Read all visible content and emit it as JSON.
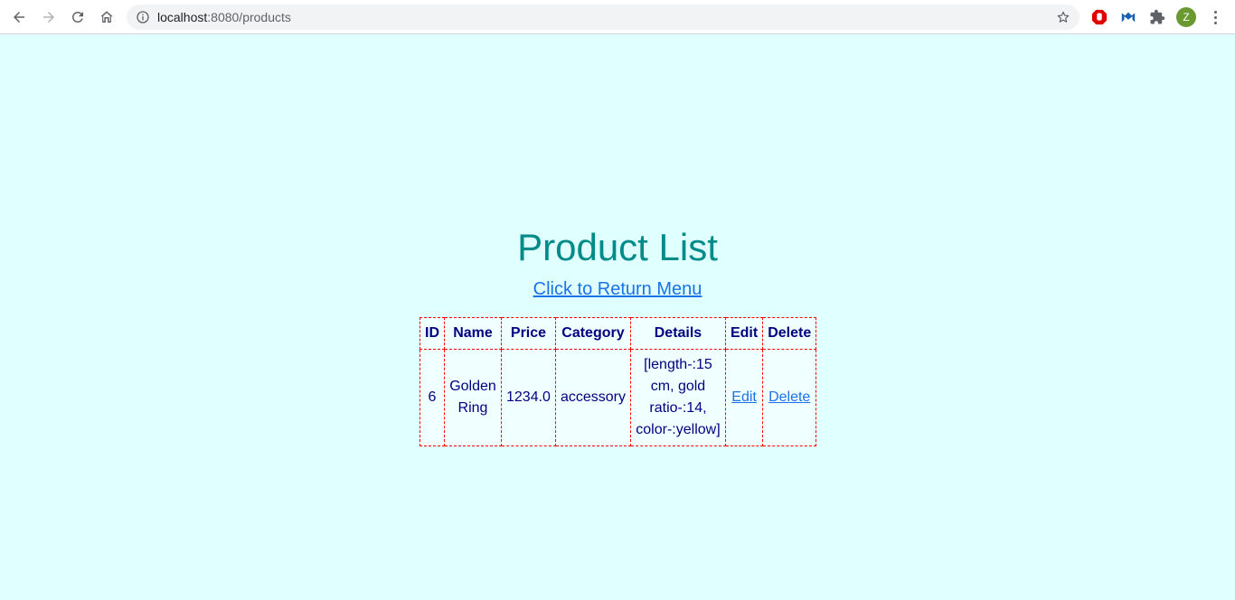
{
  "browser": {
    "url_host": "localhost",
    "url_rest": ":8080/products",
    "avatar_letter": "Z"
  },
  "page": {
    "title": "Product List",
    "return_link": "Click to Return Menu"
  },
  "table": {
    "headers": [
      "ID",
      "Name",
      "Price",
      "Category",
      "Details",
      "Edit",
      "Delete"
    ],
    "rows": [
      {
        "id": "6",
        "name": "Golden Ring",
        "price": "1234.0",
        "category": "accessory",
        "details": "[length-:15 cm, gold ratio-:14, color-:yellow]",
        "edit": "Edit",
        "delete": "Delete"
      }
    ]
  },
  "colors": {
    "page_background": "#e0ffff",
    "title": "#008b8b",
    "table_text": "#000080",
    "table_border": "#ff0000",
    "link": "#1a73e8"
  }
}
